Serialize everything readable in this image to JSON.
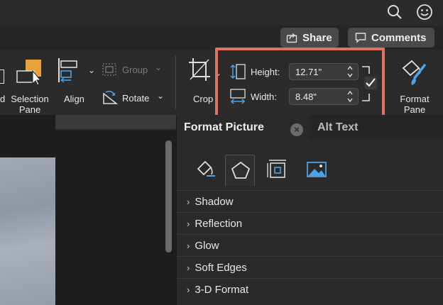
{
  "header": {
    "share_label": "Share",
    "comments_label": "Comments"
  },
  "ribbon": {
    "selection_pane_line1": "Selection",
    "selection_pane_line2": "Pane",
    "left_cut_label": "d",
    "align_label": "Align",
    "group_label": "Group",
    "rotate_label": "Rotate",
    "crop_label": "Crop",
    "format_pane_line1": "Format",
    "format_pane_line2": "Pane"
  },
  "size": {
    "height_label": "Height:",
    "height_value": "12.71\"",
    "width_label": "Width:",
    "width_value": "8.48\""
  },
  "panel": {
    "tab_format_picture": "Format Picture",
    "tab_alt_text": "Alt Text",
    "sections": [
      "Shadow",
      "Reflection",
      "Glow",
      "Soft Edges",
      "3-D Format"
    ]
  },
  "colors": {
    "highlight": "#e0705f",
    "accent_blue": "#4aa3e8"
  }
}
